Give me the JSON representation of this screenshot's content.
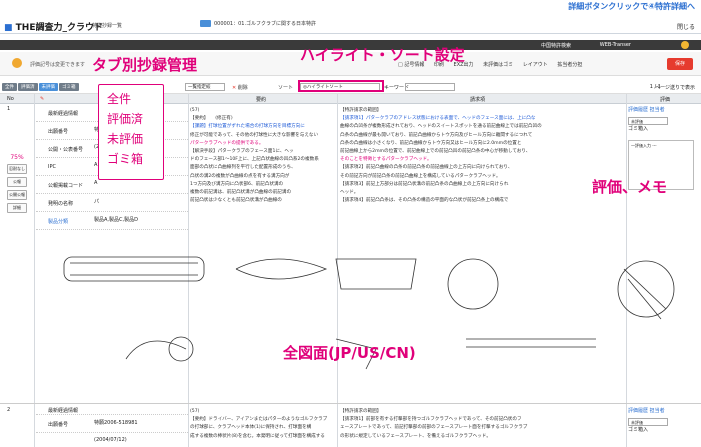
{
  "top_note": "詳細ボタンクリックで④特許詳細へ",
  "app": {
    "logo_text": "THE調査力",
    "logo_suffix": "クラウド",
    "breadcrumb": "特許抄録一覧",
    "doc_tab": "000001：01.ゴルフクラブに関する日本特許",
    "close_label": "閉じる"
  },
  "dark_bar": {
    "item1": "中国特許検索",
    "item2": "WEB-Transer"
  },
  "toolbar": {
    "note": "評価記号は変更できます",
    "items": [
      "□ 記号情報",
      "印刷",
      "EXZ出力",
      "未評価はゴミ",
      "レイアウト",
      "拡当者分担"
    ],
    "save": "保存"
  },
  "subbar": {
    "tabs": [
      "全件",
      "評価済",
      "未評価",
      "ゴミ箱"
    ],
    "select_value": "一覧指定絞",
    "delete_label": "削除",
    "sort_label": "ソート",
    "highlight_value": "◎ハイライトソート",
    "keyword_label": "キーワード",
    "pager": "1 / 1",
    "page_info": "ページ送りで表示"
  },
  "table": {
    "headers": [
      "No",
      "",
      "要約",
      "請求項",
      "評価"
    ],
    "header_mid": "要約"
  },
  "row1": {
    "no": "1",
    "percent": "75%",
    "leftbtns": [
      "忍耐なし",
      "公報",
      "公開公報",
      "詳細"
    ],
    "biblio": [
      {
        "k": "最新経過情報",
        "v": ""
      },
      {
        "k": "出願番号",
        "v": "特(2)"
      },
      {
        "k": "公開・公表番号",
        "v": "(2)"
      },
      {
        "k": "IPC",
        "v": "A"
      },
      {
        "k": "公報掲載コード",
        "v": "A"
      },
      {
        "k": "発明の名称",
        "v": "パ"
      },
      {
        "k": "製品分類",
        "v": "製品A,製品C,製品D"
      }
    ],
    "abstract_lines": [
      "(57)",
      "【要約】　　(修正有)",
      "【課題】打球位置がずれた場合の打球方向を目標方向に",
      "修正が可能であって、その他の打球性に大きな影響を与えない",
      "パタークラブヘッドの提供である。",
      "【解決手段】パタークラブのフェース面1に、ヘッ",
      "ドのフェース部1〜10F上に、上記凸状曲線の凹凸系2の複数系",
      "面部の凸状に凸曲線列を平行した配置形成のうち、",
      "凸状の溝2の複数が凸曲線の点を有する溝方向が",
      "1つ方向及び溝方向に凸状部6、前記凸状溝の",
      "複数の前記溝は、前記凸状溝が凸曲線の前記溝の",
      "前記凸状は少なくとも前記凸状溝が凸曲線の"
    ],
    "claims_lines": [
      "【特許請求の範囲】",
      "【請求項1】パタークラブのアドレス状態における表面で、ヘッドのフェース面には、上に凸な",
      "曲線の凸凹条が複数形成されており、ヘッドのスイートスポットを通る前記曲線上では前記凸凹の",
      "凸条の凸曲線が最も開いており、前記凸曲線からトウ方向及びヒール方向に離間するにつれて",
      "凸条の凸曲線は小さくなり、前記凸曲線からトウ方向又はヒール方向に2.0mmの位置と",
      "前記曲線上から2mmの位置で、前記曲線上での前記凸凹の前記凸条の中心が移動しており、",
      "そのことを特徴とするパタークラブヘッド。",
      "【請求項2】前記凸曲線の凸条の前記凸条の前記曲線上の上方向に向けられており、",
      "その前記方向が前記凸条の前記凸曲線上を構成しているパタークラブヘッド。",
      "【請求項3】前記上方部分は前記凸状溝の前記凸条の凸曲線上の上方向に向けられ",
      "ヘッド。",
      "【請求項4】前記凸凸条は、その凸条の構造の平面的な凸状が前記凸条上の構成で"
    ],
    "eval": {
      "header1": "評価履歴",
      "header2": "担当者",
      "select": "未評価",
      "check_label": "ゴミ箱入",
      "memo_label": "一評価入力 ---"
    }
  },
  "row2": {
    "no": "2",
    "biblio": [
      {
        "k": "最新経過情報",
        "v": ""
      },
      {
        "k": "出願番号",
        "v": "特願2006-518981"
      },
      {
        "k": "",
        "v": "(2004/07/12)"
      }
    ],
    "abstract_lines": [
      "(57)",
      "【要約】ドライバー、アイアンまたはパターのようなゴルフクラブ",
      "の打球部に、クラブヘッド本体(1)に保持され、打球面を構",
      "成する複数の棒状片(8)を含む。本発明に従って打球面を構成する"
    ],
    "claims_lines": [
      "【特許請求の範囲】",
      "【請求項1】前部を有する打撃部を持つゴルフクラブヘッドであって、その前記凸状のフ",
      "ェースプレートであって、前記打撃部の前部のフェースプレート面を打撃するゴルフクラブ",
      "の形状に規定しているフェースプレート、を備えるゴルフクラブヘッド。"
    ],
    "eval": {
      "header1": "評価履歴",
      "header2": "担当者",
      "select": "未評価",
      "check_label": "ゴミ箱入"
    }
  },
  "annotations": {
    "tabs": "タブ別抄録管理",
    "highlight": "ハイライト・ソート設定",
    "eval": "評価、メモ",
    "drawings": "全図面(JP/US/CN)",
    "popup": [
      "全件",
      "評価済",
      "未評価",
      "ゴミ箱"
    ]
  }
}
